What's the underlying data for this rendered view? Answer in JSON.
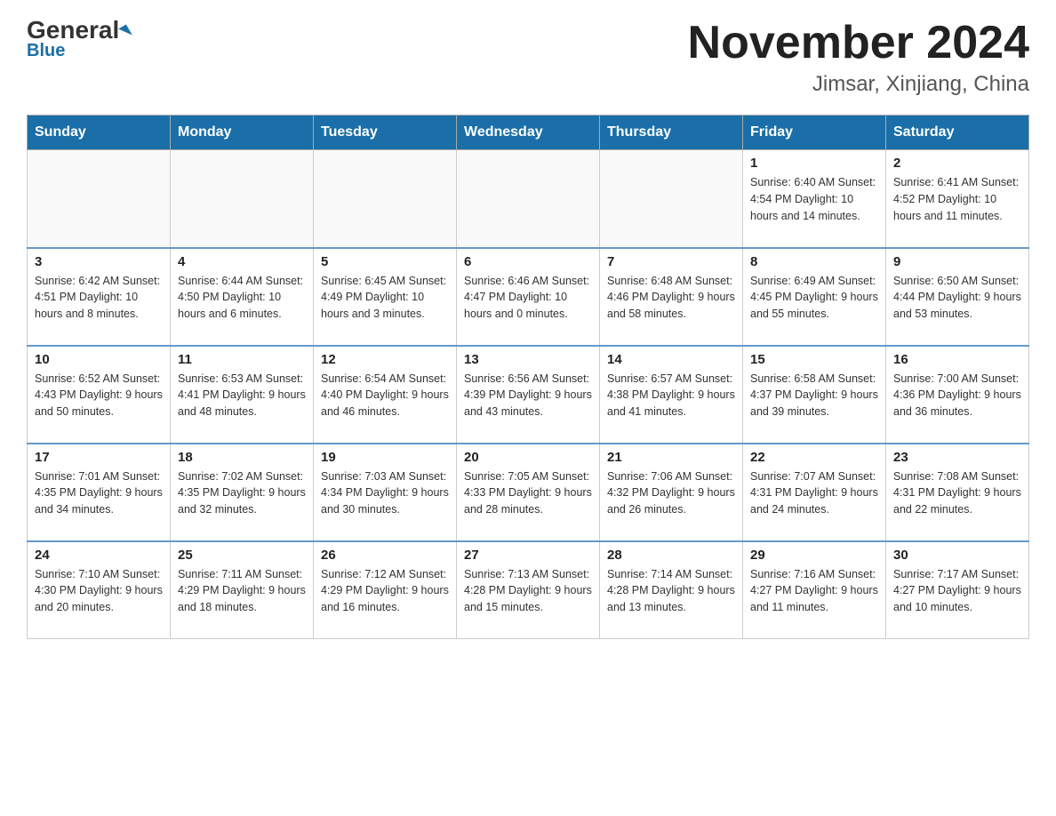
{
  "header": {
    "logo_general": "General",
    "logo_blue": "Blue",
    "title": "November 2024",
    "subtitle": "Jimsar, Xinjiang, China"
  },
  "weekdays": [
    "Sunday",
    "Monday",
    "Tuesday",
    "Wednesday",
    "Thursday",
    "Friday",
    "Saturday"
  ],
  "weeks": [
    [
      {
        "day": "",
        "info": ""
      },
      {
        "day": "",
        "info": ""
      },
      {
        "day": "",
        "info": ""
      },
      {
        "day": "",
        "info": ""
      },
      {
        "day": "",
        "info": ""
      },
      {
        "day": "1",
        "info": "Sunrise: 6:40 AM\nSunset: 4:54 PM\nDaylight: 10 hours\nand 14 minutes."
      },
      {
        "day": "2",
        "info": "Sunrise: 6:41 AM\nSunset: 4:52 PM\nDaylight: 10 hours\nand 11 minutes."
      }
    ],
    [
      {
        "day": "3",
        "info": "Sunrise: 6:42 AM\nSunset: 4:51 PM\nDaylight: 10 hours\nand 8 minutes."
      },
      {
        "day": "4",
        "info": "Sunrise: 6:44 AM\nSunset: 4:50 PM\nDaylight: 10 hours\nand 6 minutes."
      },
      {
        "day": "5",
        "info": "Sunrise: 6:45 AM\nSunset: 4:49 PM\nDaylight: 10 hours\nand 3 minutes."
      },
      {
        "day": "6",
        "info": "Sunrise: 6:46 AM\nSunset: 4:47 PM\nDaylight: 10 hours\nand 0 minutes."
      },
      {
        "day": "7",
        "info": "Sunrise: 6:48 AM\nSunset: 4:46 PM\nDaylight: 9 hours\nand 58 minutes."
      },
      {
        "day": "8",
        "info": "Sunrise: 6:49 AM\nSunset: 4:45 PM\nDaylight: 9 hours\nand 55 minutes."
      },
      {
        "day": "9",
        "info": "Sunrise: 6:50 AM\nSunset: 4:44 PM\nDaylight: 9 hours\nand 53 minutes."
      }
    ],
    [
      {
        "day": "10",
        "info": "Sunrise: 6:52 AM\nSunset: 4:43 PM\nDaylight: 9 hours\nand 50 minutes."
      },
      {
        "day": "11",
        "info": "Sunrise: 6:53 AM\nSunset: 4:41 PM\nDaylight: 9 hours\nand 48 minutes."
      },
      {
        "day": "12",
        "info": "Sunrise: 6:54 AM\nSunset: 4:40 PM\nDaylight: 9 hours\nand 46 minutes."
      },
      {
        "day": "13",
        "info": "Sunrise: 6:56 AM\nSunset: 4:39 PM\nDaylight: 9 hours\nand 43 minutes."
      },
      {
        "day": "14",
        "info": "Sunrise: 6:57 AM\nSunset: 4:38 PM\nDaylight: 9 hours\nand 41 minutes."
      },
      {
        "day": "15",
        "info": "Sunrise: 6:58 AM\nSunset: 4:37 PM\nDaylight: 9 hours\nand 39 minutes."
      },
      {
        "day": "16",
        "info": "Sunrise: 7:00 AM\nSunset: 4:36 PM\nDaylight: 9 hours\nand 36 minutes."
      }
    ],
    [
      {
        "day": "17",
        "info": "Sunrise: 7:01 AM\nSunset: 4:35 PM\nDaylight: 9 hours\nand 34 minutes."
      },
      {
        "day": "18",
        "info": "Sunrise: 7:02 AM\nSunset: 4:35 PM\nDaylight: 9 hours\nand 32 minutes."
      },
      {
        "day": "19",
        "info": "Sunrise: 7:03 AM\nSunset: 4:34 PM\nDaylight: 9 hours\nand 30 minutes."
      },
      {
        "day": "20",
        "info": "Sunrise: 7:05 AM\nSunset: 4:33 PM\nDaylight: 9 hours\nand 28 minutes."
      },
      {
        "day": "21",
        "info": "Sunrise: 7:06 AM\nSunset: 4:32 PM\nDaylight: 9 hours\nand 26 minutes."
      },
      {
        "day": "22",
        "info": "Sunrise: 7:07 AM\nSunset: 4:31 PM\nDaylight: 9 hours\nand 24 minutes."
      },
      {
        "day": "23",
        "info": "Sunrise: 7:08 AM\nSunset: 4:31 PM\nDaylight: 9 hours\nand 22 minutes."
      }
    ],
    [
      {
        "day": "24",
        "info": "Sunrise: 7:10 AM\nSunset: 4:30 PM\nDaylight: 9 hours\nand 20 minutes."
      },
      {
        "day": "25",
        "info": "Sunrise: 7:11 AM\nSunset: 4:29 PM\nDaylight: 9 hours\nand 18 minutes."
      },
      {
        "day": "26",
        "info": "Sunrise: 7:12 AM\nSunset: 4:29 PM\nDaylight: 9 hours\nand 16 minutes."
      },
      {
        "day": "27",
        "info": "Sunrise: 7:13 AM\nSunset: 4:28 PM\nDaylight: 9 hours\nand 15 minutes."
      },
      {
        "day": "28",
        "info": "Sunrise: 7:14 AM\nSunset: 4:28 PM\nDaylight: 9 hours\nand 13 minutes."
      },
      {
        "day": "29",
        "info": "Sunrise: 7:16 AM\nSunset: 4:27 PM\nDaylight: 9 hours\nand 11 minutes."
      },
      {
        "day": "30",
        "info": "Sunrise: 7:17 AM\nSunset: 4:27 PM\nDaylight: 9 hours\nand 10 minutes."
      }
    ]
  ]
}
